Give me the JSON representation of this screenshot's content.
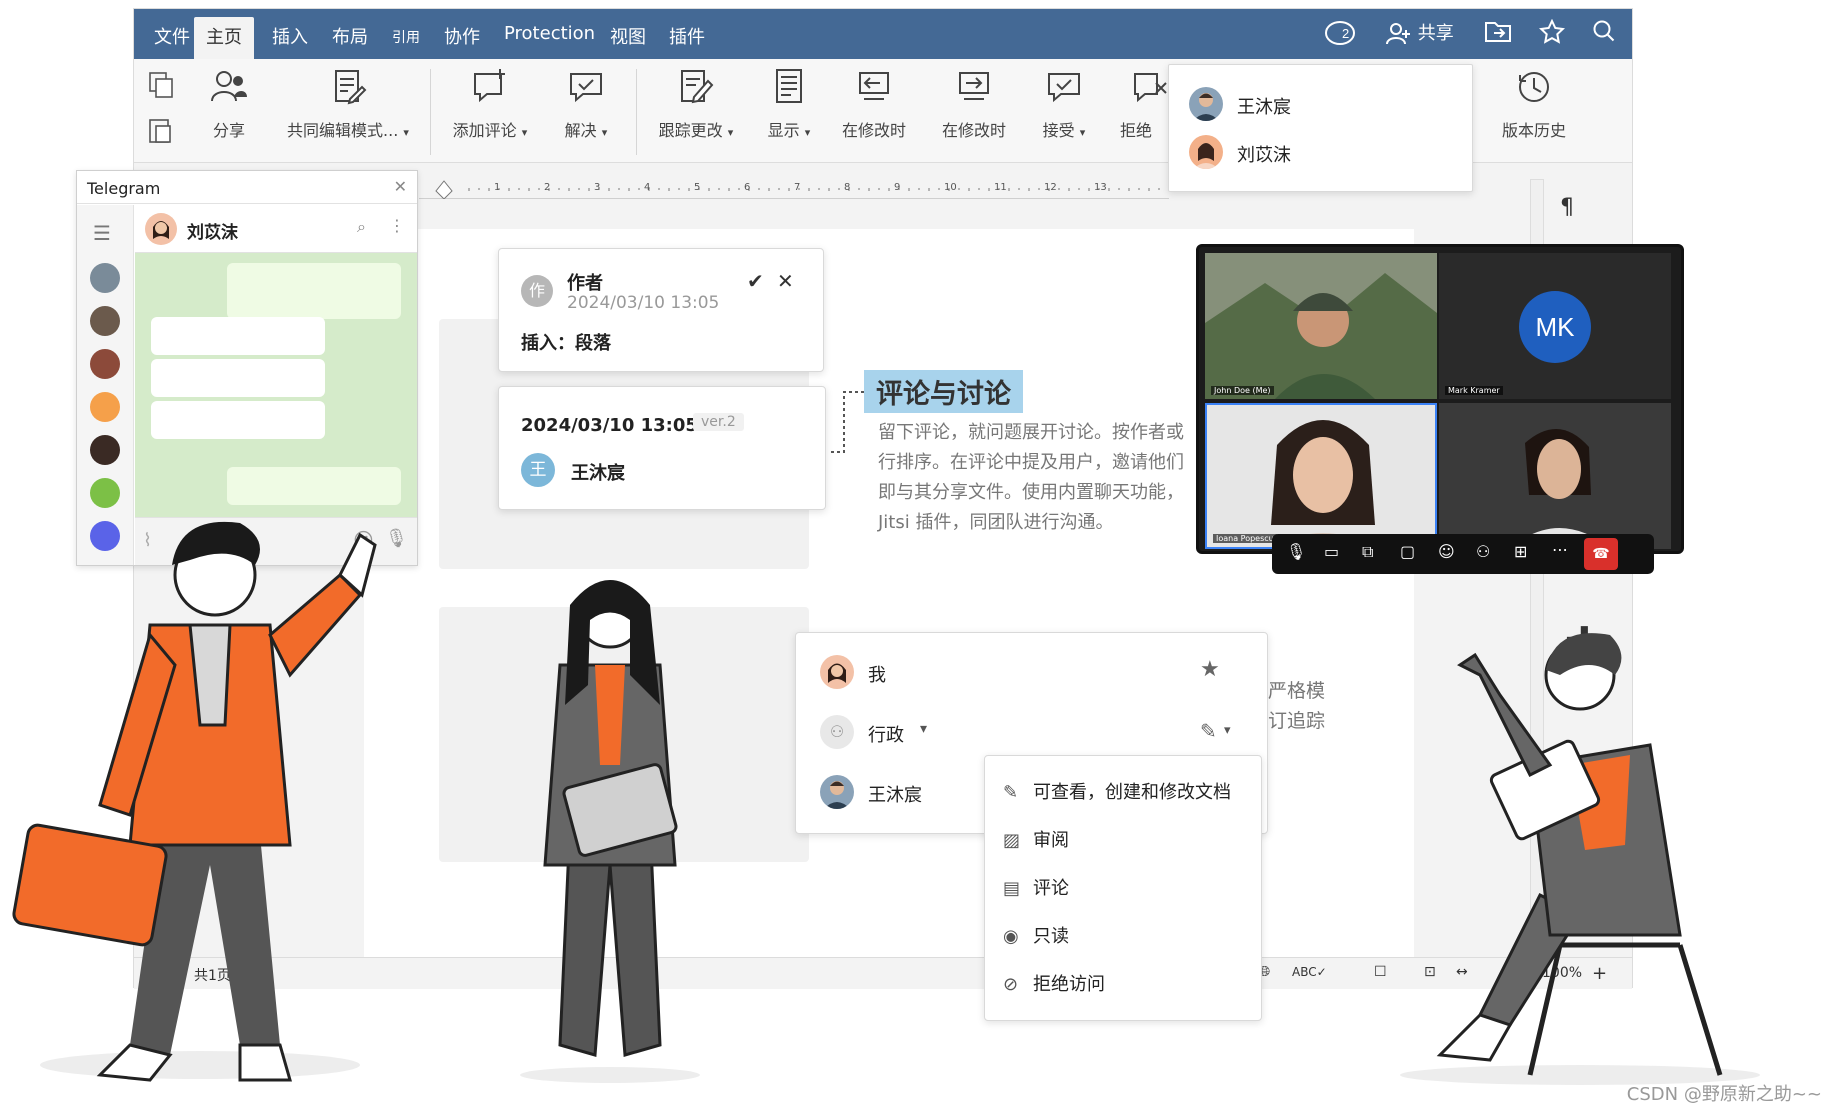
{
  "menu": {
    "items": [
      "文件",
      "主页",
      "插入",
      "布局",
      "引用",
      "协作",
      "Protection",
      "视图",
      "插件"
    ],
    "active_index": 1,
    "right": {
      "badge": "2",
      "share": "共享"
    }
  },
  "toolbar": {
    "share": "分享",
    "coedit": "共同编辑模式...",
    "add_comment": "添加评论",
    "resolve": "解决",
    "track": "跟踪更改",
    "display": "显示",
    "prev_change": "在修改时",
    "next_change": "在修改时",
    "accept": "接受",
    "reject": "拒绝",
    "history": "版本历史"
  },
  "users_dropdown": [
    "王沐宸",
    "刘苡沫"
  ],
  "ruler": [
    "1",
    "2",
    "3",
    "4",
    "5",
    "6",
    "7",
    "8",
    "9",
    "10",
    "11",
    "12",
    "13"
  ],
  "telegram": {
    "title": "Telegram",
    "contact": "刘苡沫"
  },
  "change_card": {
    "author_initial": "作",
    "author": "作者",
    "time": "2024/03/10 13:05",
    "action": "插入：段落"
  },
  "version_card": {
    "time": "2024/03/10 13:05",
    "version": "ver.2",
    "user_initial": "王",
    "user": "王沐宸"
  },
  "doc": {
    "heading": "评论与讨论",
    "lines": [
      "留下评论，就问题展开讨论。按作者或",
      "行排序。在评论中提及用户，邀请他们",
      "即与其分享文件。使用内置聊天功能，",
      "Jitsi 插件，同团队进行沟通。"
    ],
    "side_text": [
      "严格模",
      "订追踪"
    ]
  },
  "video": {
    "initials": "MK",
    "names": [
      "John Doe (Me)",
      "Mark Kramer",
      "Ioana Popescu"
    ]
  },
  "share_panel": {
    "me": "我",
    "group": "行政",
    "user": "王沐宸"
  },
  "permissions": [
    "可查看，创建和修改文档",
    "审阅",
    "评论",
    "只读",
    "拒绝访问"
  ],
  "status": {
    "pages": "共1页",
    "zoom": "100%"
  },
  "credit": "CSDN @野原新之助~~",
  "colors": {
    "menubar": "#446995",
    "accent_orange": "#f26b2a",
    "chat_bg": "#d5ebca",
    "heading_bg": "#a8d3ec",
    "end_call": "#d9302b",
    "mk_avatar": "#1f5fbf"
  }
}
